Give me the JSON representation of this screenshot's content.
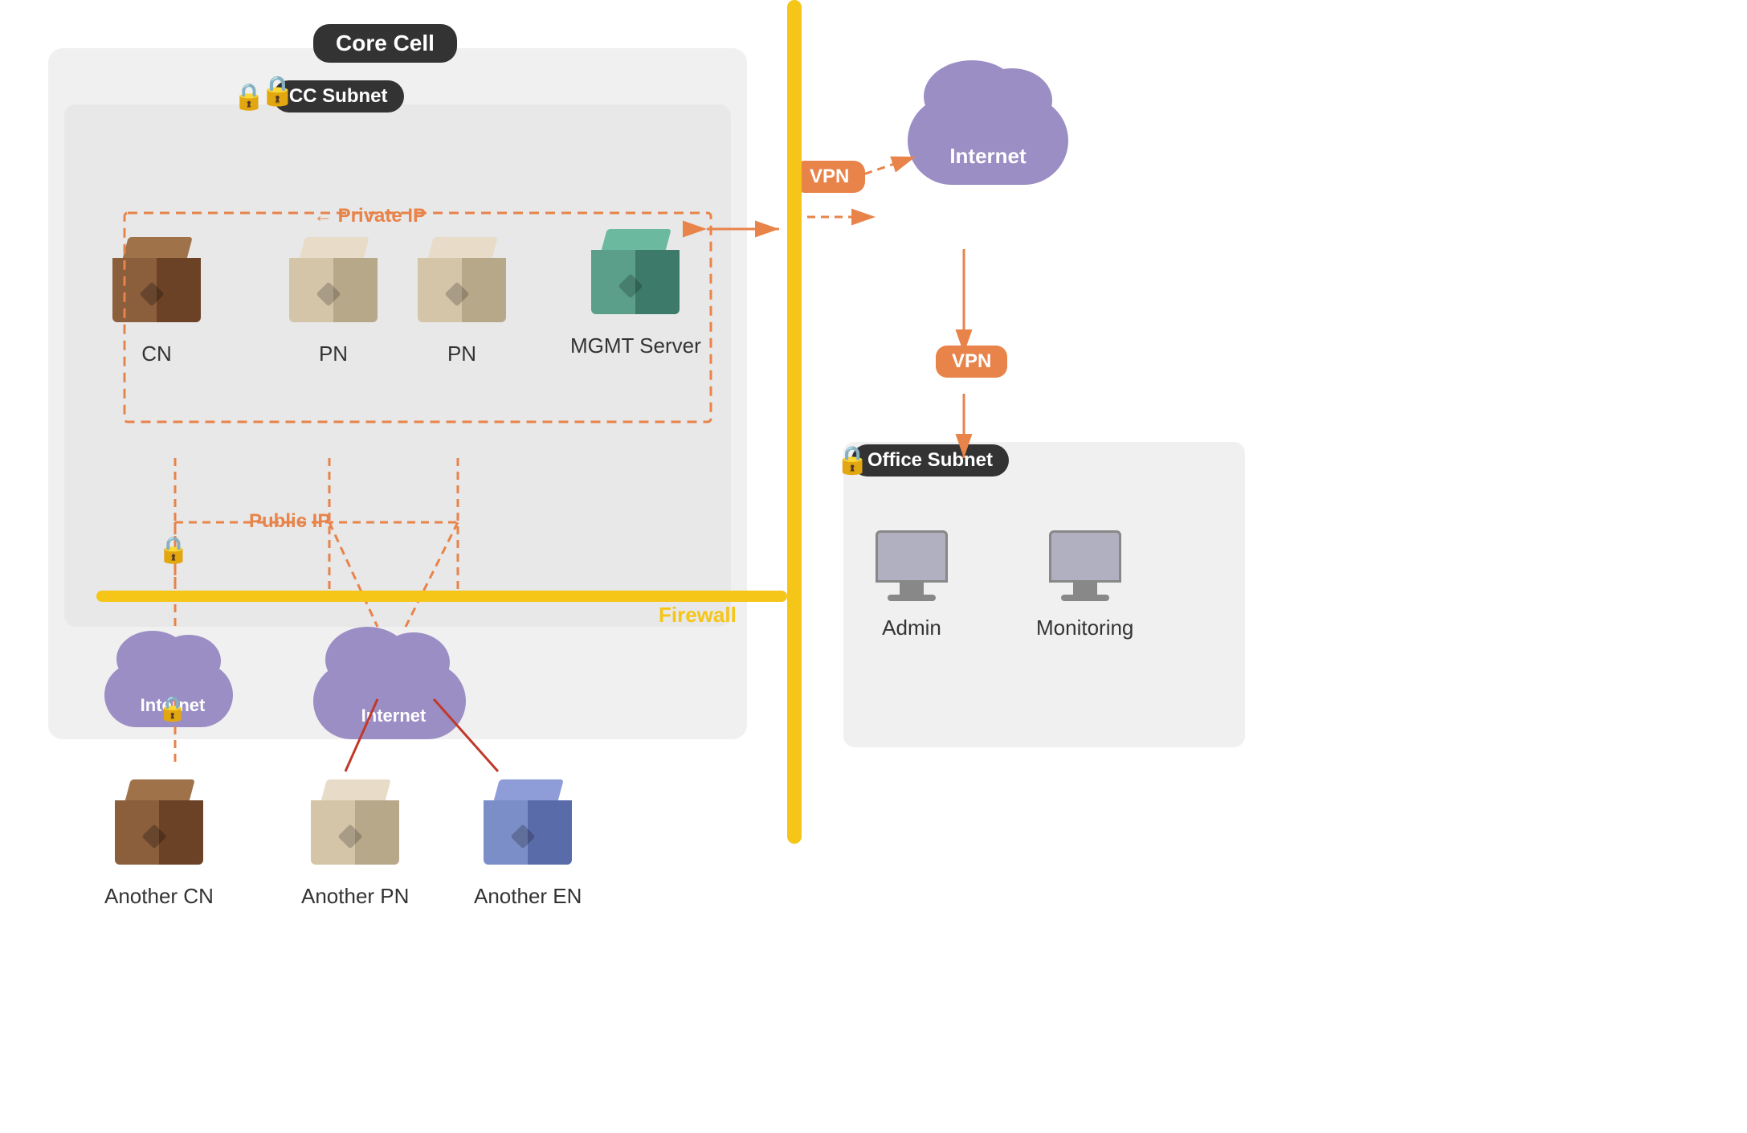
{
  "labels": {
    "core_cell": "Core Cell",
    "cc_subnet": "CC Subnet",
    "office_subnet": "Office Subnet",
    "vpn": "VPN",
    "vpn2": "VPN",
    "firewall": "Firewall",
    "internet": "Internet",
    "internet2": "Internet",
    "internet3": "Internet",
    "private_ip": "Private IP",
    "public_ip": "Public IP",
    "cn": "CN",
    "pn1": "PN",
    "pn2": "PN",
    "mgmt_server": "MGMT Server",
    "another_cn": "Another CN",
    "another_pn": "Another PN",
    "another_en": "Another EN",
    "admin": "Admin",
    "monitoring": "Monitoring"
  },
  "colors": {
    "dark_bg": "#333333",
    "gold": "#F5C518",
    "orange": "#E8834A",
    "cloud_purple": "#9B8EC4",
    "cn_brown": "#8B5E3C",
    "pn_beige": "#D4C4A8",
    "mgmt_teal": "#5B9E8A",
    "en_blue": "#7B8EC8",
    "region_bg": "#f0f0f0",
    "inner_region_bg": "#e8e8e8"
  }
}
